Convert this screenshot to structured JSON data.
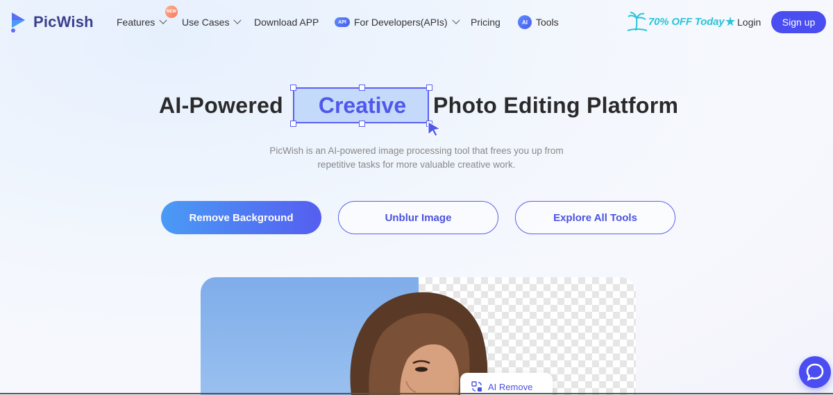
{
  "brand": {
    "name": "PicWish"
  },
  "nav": {
    "items": [
      {
        "label": "Features",
        "dropdown": true
      },
      {
        "label": "Use Cases",
        "dropdown": true
      },
      {
        "label": "Download APP",
        "dropdown": false
      },
      {
        "label": "For Developers(APIs)",
        "dropdown": true
      },
      {
        "label": "Pricing",
        "dropdown": false
      },
      {
        "label": "Tools",
        "dropdown": false
      }
    ],
    "new_badge": "NEW",
    "api_badge": "API",
    "ai_badge": "AI",
    "promo": "70% OFF Today",
    "login": "Login",
    "signup": "Sign up"
  },
  "hero": {
    "word_before": "AI-Powered",
    "highlight": "Creative",
    "word_after": "Photo Editing Platform",
    "subtitle_line1": "PicWish is an AI-powered image processing tool that frees you up from",
    "subtitle_line2": "repetitive tasks for more valuable creative work.",
    "buttons": {
      "primary": "Remove Background",
      "secondary": "Unblur Image",
      "tertiary": "Explore All Tools"
    }
  },
  "demo": {
    "badge_label": "AI Remove"
  },
  "colors": {
    "accent": "#4a4ef0",
    "promo": "#2bc3d9",
    "highlight_bg": "#bad3fa"
  }
}
